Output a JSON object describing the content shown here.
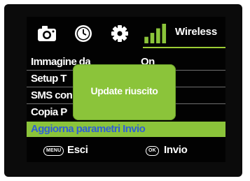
{
  "topbar": {
    "icons": [
      "camera-icon",
      "clock-icon",
      "gear-icon",
      "signal-bars-icon"
    ],
    "active_tab_label": "Wireless"
  },
  "menu": {
    "items": [
      {
        "label": "Immagine da",
        "value": "On"
      },
      {
        "label": "Setup T"
      },
      {
        "label": "SMS con"
      },
      {
        "label": "Copia P"
      },
      {
        "label": "Aggiorna parametri Invio"
      }
    ],
    "selected_index": 4
  },
  "popup": {
    "message": "Update riuscito"
  },
  "footer": {
    "menu_key": "MENU",
    "menu_label": "Esci",
    "ok_key": "OK",
    "ok_label": "Invio"
  },
  "colors": {
    "accent_green": "#8bc43a",
    "selected_text": "#2f5fd6",
    "background": "#020202"
  }
}
